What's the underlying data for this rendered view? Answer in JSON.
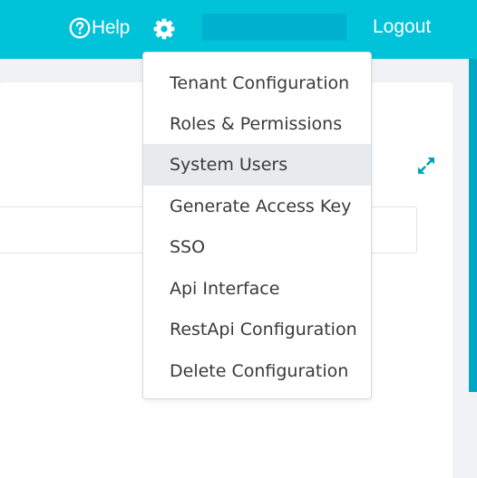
{
  "header": {
    "help_label": "Help",
    "logout_label": "Logout",
    "icons": {
      "help": "question-circle-icon",
      "settings": "gear-icon"
    },
    "colors": {
      "bar": "#00c2d9",
      "user_box": "#00b1cf"
    }
  },
  "settings_menu": {
    "items": [
      {
        "label": "Tenant Configuration"
      },
      {
        "label": "Roles & Permissions"
      },
      {
        "label": "System Users",
        "active": true
      },
      {
        "label": "Generate Access Key"
      },
      {
        "label": "SSO"
      },
      {
        "label": "Api Interface"
      },
      {
        "label": "RestApi Configuration"
      },
      {
        "label": "Delete Configuration"
      }
    ]
  },
  "panel": {
    "icons": {
      "expand": "expand-arrows-icon"
    },
    "accent_color": "#00a3b4"
  }
}
